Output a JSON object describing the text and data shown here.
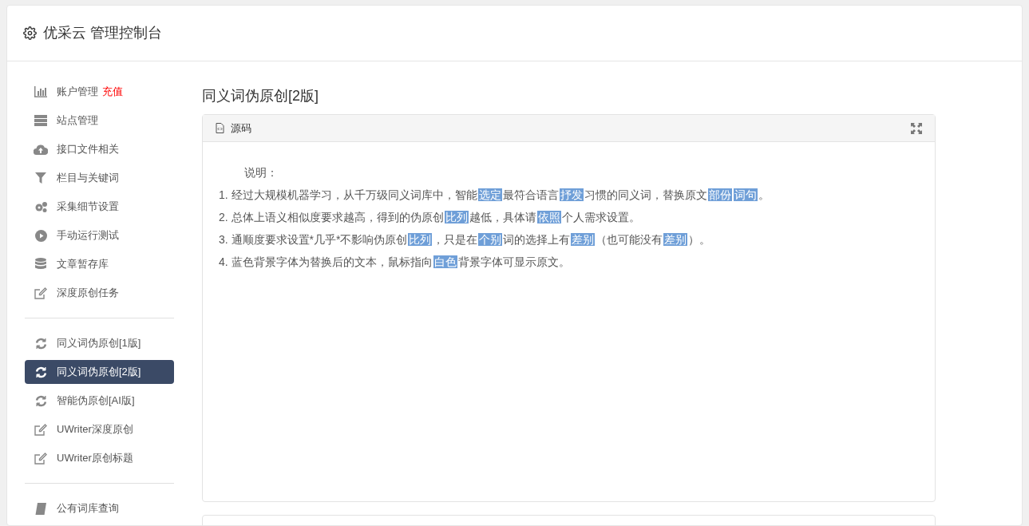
{
  "header": {
    "title": "优采云 管理控制台"
  },
  "sidebar": {
    "groups": [
      {
        "items": [
          {
            "label": "账户管理",
            "badge": "充值",
            "selected": false
          },
          {
            "label": "站点管理",
            "selected": false
          },
          {
            "label": "接口文件相关",
            "selected": false
          },
          {
            "label": "栏目与关键词",
            "selected": false
          },
          {
            "label": "采集细节设置",
            "selected": false
          },
          {
            "label": "手动运行测试",
            "selected": false
          },
          {
            "label": "文章暂存库",
            "selected": false
          },
          {
            "label": "深度原创任务",
            "selected": false
          }
        ]
      },
      {
        "items": [
          {
            "label": "同义词伪原创[1版]",
            "selected": false
          },
          {
            "label": "同义词伪原创[2版]",
            "selected": true
          },
          {
            "label": "智能伪原创[AI版]",
            "selected": false
          },
          {
            "label": "UWriter深度原创",
            "selected": false
          },
          {
            "label": "UWriter原创标题",
            "selected": false
          }
        ]
      },
      {
        "items": [
          {
            "label": "公有词库查询",
            "selected": false
          }
        ]
      }
    ]
  },
  "page_title": "同义词伪原创[2版]",
  "panel": {
    "title": "源码",
    "intro": "说明：",
    "notes": [
      {
        "number": "1.",
        "segments": [
          {
            "text": "经过大规模机器学习，从千万级同义词库中，智能",
            "highlighted": false
          },
          {
            "text": "选定",
            "highlighted": true
          },
          {
            "text": "最符合语言",
            "highlighted": false
          },
          {
            "text": "抒发",
            "highlighted": true
          },
          {
            "text": "习惯的同义词，替换原文",
            "highlighted": false
          },
          {
            "text": "部份",
            "highlighted": true
          },
          {
            "text": "词句",
            "highlighted": true
          },
          {
            "text": "。",
            "highlighted": false
          }
        ]
      },
      {
        "number": "2.",
        "segments": [
          {
            "text": "总体上语义相似度要求越高，得到的伪原创",
            "highlighted": false
          },
          {
            "text": "比列",
            "highlighted": true
          },
          {
            "text": "越低，具体请",
            "highlighted": false
          },
          {
            "text": "依照",
            "highlighted": true
          },
          {
            "text": "个人需求设置。",
            "highlighted": false
          }
        ]
      },
      {
        "number": "3.",
        "segments": [
          {
            "text": "通顺度要求设置*几乎*不影响伪原创",
            "highlighted": false
          },
          {
            "text": "比列",
            "highlighted": true
          },
          {
            "text": "，只是在",
            "highlighted": false
          },
          {
            "text": "个别",
            "highlighted": true
          },
          {
            "text": "词的选择上有",
            "highlighted": false
          },
          {
            "text": "差别",
            "highlighted": true
          },
          {
            "text": "（也可能没有",
            "highlighted": false
          },
          {
            "text": "差别",
            "highlighted": true
          },
          {
            "text": "）。",
            "highlighted": false
          }
        ]
      },
      {
        "number": "4.",
        "segments": [
          {
            "text": "蓝色背景字体为替换后的文本，鼠标指向",
            "highlighted": false
          },
          {
            "text": "白色",
            "highlighted": true
          },
          {
            "text": "背景字体可显示原文。",
            "highlighted": false
          }
        ]
      }
    ]
  }
}
